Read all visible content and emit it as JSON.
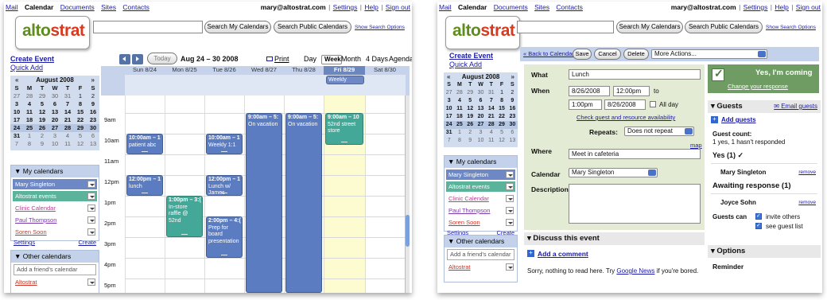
{
  "left": {
    "nav": {
      "mail": "Mail",
      "calendar": "Calendar",
      "documents": "Documents",
      "sites": "Sites",
      "contacts": "Contacts"
    },
    "account": {
      "email": "mary@altostrat.com",
      "settings": "Settings",
      "help": "Help",
      "signout": "Sign out",
      "sep": "|"
    },
    "logo": {
      "part1": "alto",
      "part2": "strat"
    },
    "search": {
      "my": "Search My Calendars",
      "public": "Search Public Calendars",
      "options": "Show Search Options"
    },
    "sidebar": {
      "create_event": "Create Event",
      "quick_add": "Quick Add"
    },
    "minical": {
      "month": "August 2008",
      "prev": "«",
      "next": "»",
      "days": [
        "S",
        "M",
        "T",
        "W",
        "T",
        "F",
        "S"
      ],
      "weeks": [
        [
          "27",
          "28",
          "29",
          "30",
          "31",
          "1",
          "2"
        ],
        [
          "3",
          "4",
          "5",
          "6",
          "7",
          "8",
          "9"
        ],
        [
          "10",
          "11",
          "12",
          "13",
          "14",
          "15",
          "16"
        ],
        [
          "17",
          "18",
          "19",
          "20",
          "21",
          "22",
          "23"
        ],
        [
          "24",
          "25",
          "26",
          "27",
          "28",
          "29",
          "30"
        ],
        [
          "31",
          "1",
          "2",
          "3",
          "4",
          "5",
          "6"
        ],
        [
          "7",
          "8",
          "9",
          "10",
          "11",
          "12",
          "13"
        ]
      ]
    },
    "my_calendars": {
      "title": "My calendars",
      "items": [
        "Mary Singleton",
        "Altostrat events",
        "Clinic Calendar",
        "Paul Thompson",
        "Soren Soon"
      ],
      "settings": "Settings",
      "create": "Create"
    },
    "other_calendars": {
      "title": "Other calendars",
      "placeholder": "Add a friend's calendar",
      "item": "Altostrat"
    },
    "toolbar": {
      "today": "Today",
      "range": "Aug 24 – 30 2008",
      "print": "Print",
      "tabs": [
        "Day",
        "Week",
        "Month",
        "4 Days",
        "Agenda"
      ],
      "selected": "Week"
    },
    "day_headers": [
      "Sun 8/24",
      "Mon 8/25",
      "Tue 8/26",
      "Wed 8/27",
      "Thu 8/28",
      "Fri 8/29",
      "Sat 8/30"
    ],
    "allday_event": "Weekly Summ",
    "hours": [
      "9am",
      "10am",
      "11am",
      "12pm",
      "1pm",
      "2pm",
      "3pm",
      "4pm",
      "5pm"
    ],
    "events": [
      {
        "head": "10:00am – 1",
        "body": "patient abc"
      },
      {
        "head": "12:00pm – 1",
        "body": "lunch"
      },
      {
        "head": "1:00pm – 3:(",
        "body": "In-store raffle @ 52nd"
      },
      {
        "head": "10:00am – 1",
        "body": "Weekly 1:1"
      },
      {
        "head": "12:00pm – 1",
        "body": "Lunch w/ James"
      },
      {
        "head": "2:00pm – 4:(",
        "body": "Prep for board presentation"
      },
      {
        "head": "9:00am – 5:",
        "body": "On vacation"
      },
      {
        "head": "9:00am – 5:",
        "body": "On vacation"
      },
      {
        "head": "9:00am – 10",
        "body": "52nd street store"
      }
    ]
  },
  "right": {
    "nav": {
      "mail": "Mail",
      "calendar": "Calendar",
      "documents": "Documents",
      "sites": "Sites",
      "contacts": "Contacts"
    },
    "account": {
      "email": "mary@altostrat.com",
      "settings": "Settings",
      "help": "Help",
      "signout": "Sign out",
      "sep": "|"
    },
    "search": {
      "my": "Search My Calendars",
      "public": "Search Public Calendars",
      "options": "Show Search Options"
    },
    "actions": {
      "back": "« Back to Calendar",
      "save": "Save",
      "cancel": "Cancel",
      "delete": "Delete",
      "more": "More Actions..."
    },
    "form": {
      "what_label": "What",
      "what": "Lunch",
      "when_label": "When",
      "start_date": "8/26/2008",
      "start_time": "12:00pm",
      "to": "to",
      "end_time": "1:00pm",
      "end_date": "8/26/2008",
      "allday": "All day",
      "check_avail": "Check guest and resource availability",
      "repeats_label": "Repeats:",
      "repeats": "Does not repeat",
      "where_label": "Where",
      "map": "map",
      "where": "Meet in cafeteria",
      "calendar_label": "Calendar",
      "calendar": "Mary Singleton",
      "description_label": "Description"
    },
    "rsvp": {
      "title": "Yes, I'm coming",
      "change": "Change your response"
    },
    "guests": {
      "title": "Guests",
      "email": "Email guests",
      "add": "Add guests",
      "count_label": "Guest count:",
      "count": "1 yes, 1 hasn't responded",
      "yes": "Yes (1) ✓",
      "g1": "Mary Singleton",
      "remove": "remove",
      "awaiting": "Awaiting response (1)",
      "g2": "Joyce Sohn",
      "can": "Guests can",
      "invite": "invite others",
      "see": "see guest list"
    },
    "options": {
      "title": "Options",
      "reminder": "Reminder"
    },
    "discuss": {
      "title": "Discuss this event",
      "add": "Add a comment",
      "msg1": "Sorry, nothing to read here. Try ",
      "gnews": "Google News",
      "msg2": " if you're bored."
    }
  }
}
